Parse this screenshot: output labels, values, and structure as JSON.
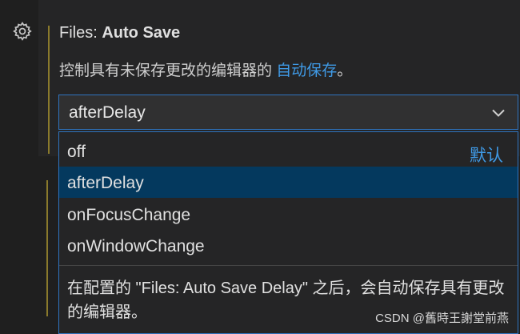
{
  "setting": {
    "title_prefix": "Files: ",
    "title_name": "Auto Save",
    "description": "控制具有未保存更改的编辑器的 ",
    "description_link": "自动保存",
    "description_suffix": "。",
    "current_value": "afterDelay"
  },
  "dropdown": {
    "options": [
      {
        "label": "off",
        "badge": "默认"
      },
      {
        "label": "afterDelay",
        "selected": true
      },
      {
        "label": "onFocusChange"
      },
      {
        "label": "onWindowChange"
      }
    ],
    "help_text": "在配置的 \"Files: Auto Save Delay\" 之后，会自动保存具有更改的编辑器。"
  },
  "watermark": "CSDN @舊時王謝堂前燕",
  "icons": {
    "gear": "gear-icon",
    "chevron": "chevron-down-icon"
  },
  "colors": {
    "accent_link": "#3f9ae6",
    "focus_border": "#2f74c0",
    "selected_bg": "#04395e",
    "modified_bar": "#8a7a2c"
  }
}
